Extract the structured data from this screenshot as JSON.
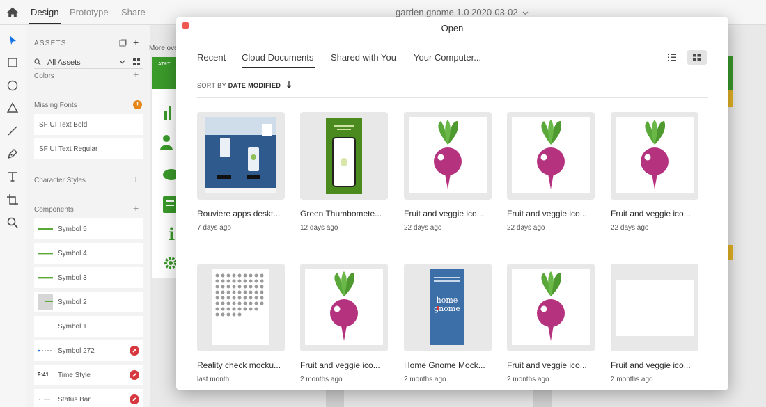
{
  "app": {
    "tabs": [
      "Design",
      "Prototype",
      "Share"
    ],
    "document_title": "garden gnome 1.0 2020-03-02"
  },
  "toolbar": {
    "tools": [
      "select-tool",
      "rectangle-tool",
      "ellipse-tool",
      "triangle-tool",
      "line-tool",
      "pen-tool",
      "text-tool",
      "artboard-tool",
      "zoom-tool"
    ]
  },
  "assets": {
    "title": "ASSETS",
    "filter": "All Assets",
    "colors_label": "Colors",
    "missing_fonts_label": "Missing Fonts",
    "missing_fonts": [
      "SF UI Text Bold",
      "SF UI Text Regular"
    ],
    "character_styles_label": "Character Styles",
    "components_label": "Components",
    "components": [
      {
        "label": "Symbol 5",
        "linked": false
      },
      {
        "label": "Symbol 4",
        "linked": false
      },
      {
        "label": "Symbol 3",
        "linked": false
      },
      {
        "label": "Symbol 2",
        "linked": false
      },
      {
        "label": "Symbol 1",
        "linked": false
      },
      {
        "label": "Symbol 272",
        "linked": true
      },
      {
        "label": "Time Style",
        "linked": true,
        "thumb_text": "9:41"
      },
      {
        "label": "Status Bar",
        "linked": true
      }
    ]
  },
  "canvas": {
    "partial_text": "More ove",
    "carrier_text": "AT&T"
  },
  "dialog": {
    "title": "Open",
    "tabs": [
      "Recent",
      "Cloud Documents",
      "Shared with You",
      "Your Computer..."
    ],
    "active_tab": "Cloud Documents",
    "view_mode": "grid",
    "sort_prefix": "SORT BY",
    "sort_field": "DATE MODIFIED",
    "files": [
      {
        "name": "Rouviere apps deskt...",
        "date": "7 days ago",
        "thumb": "web"
      },
      {
        "name": "Green Thumbomete...",
        "date": "12 days ago",
        "thumb": "green-phone"
      },
      {
        "name": "Fruit and veggie ico...",
        "date": "22 days ago",
        "thumb": "beet"
      },
      {
        "name": "Fruit and veggie ico...",
        "date": "22 days ago",
        "thumb": "beet"
      },
      {
        "name": "Fruit and veggie ico...",
        "date": "22 days ago",
        "thumb": "beet"
      },
      {
        "name": "Reality check mocku...",
        "date": "last month",
        "thumb": "icon-grid"
      },
      {
        "name": "Fruit and veggie ico...",
        "date": "2 months ago",
        "thumb": "beet"
      },
      {
        "name": "Home Gnome Mock...",
        "date": "2 months ago",
        "thumb": "home-gnome",
        "thumb_text": "home gnome"
      },
      {
        "name": "Fruit and veggie ico...",
        "date": "2 months ago",
        "thumb": "beet"
      },
      {
        "name": "Fruit and veggie ico...",
        "date": "2 months ago",
        "thumb": "blank"
      }
    ]
  },
  "colors": {
    "accent": "#2c2c2c",
    "warning": "#e68619",
    "link_badge": "#d7373f",
    "beet": "#b5327f",
    "leaf": "#5aa83a",
    "close": "#ee5a52"
  }
}
